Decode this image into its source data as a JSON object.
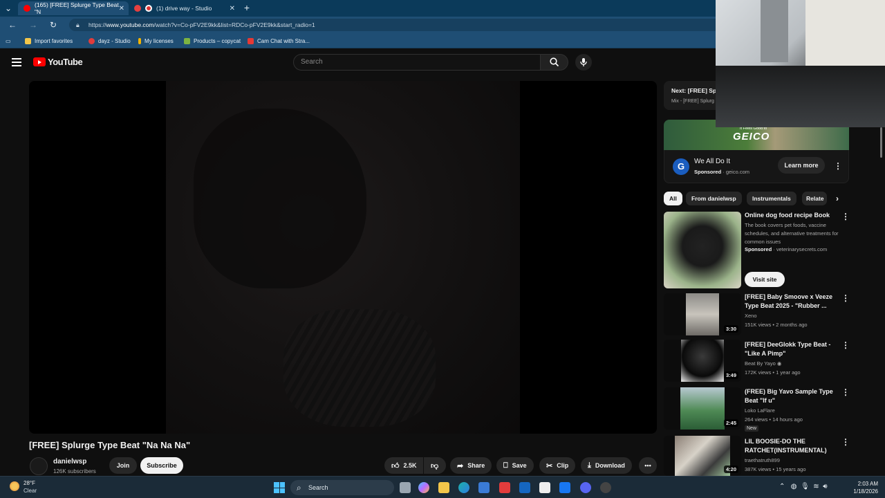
{
  "browser": {
    "tabs": [
      {
        "label": "(165) [FREE] Splurge Type Beat \"N",
        "active": true
      },
      {
        "label": "(1) drive way - Studio",
        "active": false
      }
    ],
    "new_tab_glyph": "+",
    "url_prefix": "https://",
    "url_domain": "www.youtube.com",
    "url_rest": "/watch?v=Co-pFV2E9kk&list=RDCo-pFV2E9kk&start_radio=1",
    "bookmarks": [
      {
        "label": "Import favorites",
        "color": "#f3c64a"
      },
      {
        "label": "dayz - Studio",
        "color": "#e23c3c"
      },
      {
        "label": "My licenses",
        "color": "#f4b400"
      },
      {
        "label": "Products – copycat",
        "color": "#7cb342"
      },
      {
        "label": "Cam Chat with Stra...",
        "color": "#e53935"
      }
    ]
  },
  "youtube": {
    "logo_text": "YouTube",
    "search_placeholder": "Search"
  },
  "video": {
    "title": "[FREE] Splurge Type Beat \"Na Na Na\"",
    "channel": "danielwsp",
    "subscribers": "126K subscribers",
    "join_label": "Join",
    "subscribe_label": "Subscribe",
    "likes": "2.5K",
    "share_label": "Share",
    "save_label": "Save",
    "clip_label": "Clip",
    "download_label": "Download"
  },
  "sidebar": {
    "next_label": "Next: [FREE] Sp",
    "next_sub": "Mix - [FREE] Splurg",
    "ad": {
      "banner_tag": "It Feels Good to",
      "banner_brand": "GEICO",
      "logo_letter": "G",
      "title": "We All Do It",
      "sponsored": "Sponsored",
      "domain": "geico.com",
      "cta": "Learn more"
    },
    "chips": [
      "All",
      "From danielwsp",
      "Instrumentals",
      "Relate"
    ],
    "promo": {
      "title": "Online dog food recipe Book",
      "desc": "The book covers pet foods, vaccine schedules, and alternative treatments for common issues",
      "sponsored": "Sponsored",
      "domain": "veterinarysecrets.com",
      "cta": "Visit site"
    },
    "videos": [
      {
        "title": "[FREE] Baby Smoove x Veeze Type Beat 2025 - \"Rubber ...",
        "channel": "Xeno",
        "meta": "151K views • 2 months ago",
        "duration": "3:30"
      },
      {
        "title": "[FREE] DeeGlokk Type Beat - \"Like A Pimp\"",
        "channel": "Beat By Yayo",
        "meta": "172K views • 1 year ago",
        "duration": "3:49"
      },
      {
        "title": "(FREE) Big Yavo Sample Type Beat \"If u\"",
        "channel": "Loko LaFlare",
        "meta": "264 views • 14 hours ago",
        "duration": "2:45",
        "badge": "New"
      },
      {
        "title": "LIL BOOSIE-DO THE RATCHET(INSTRUMENTAL)",
        "channel": "traethatruth899",
        "meta": "387K views • 15 years ago",
        "duration": "4:20"
      }
    ]
  },
  "taskbar": {
    "temp": "28°F",
    "condition": "Clear",
    "search_label": "Search",
    "time": "2:03 AM",
    "date": "1/18/2026"
  }
}
